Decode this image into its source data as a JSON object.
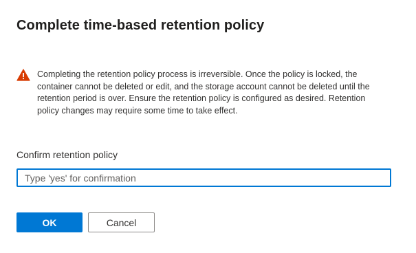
{
  "dialog": {
    "title": "Complete time-based retention policy",
    "warning": {
      "icon": "warning-icon",
      "icon_color": "#d83b01",
      "text": "Completing the retention policy process is irreversible. Once the policy is locked, the container cannot be deleted or edit, and the storage account cannot be deleted until the retention period is over. Ensure the retention policy is configured as desired. Retention policy changes may require some time to take effect."
    },
    "confirm_field": {
      "label": "Confirm retention policy",
      "value": "",
      "placeholder": "Type 'yes' for confirmation"
    },
    "buttons": {
      "ok_label": "OK",
      "cancel_label": "Cancel"
    },
    "colors": {
      "accent": "#0078d4"
    }
  }
}
